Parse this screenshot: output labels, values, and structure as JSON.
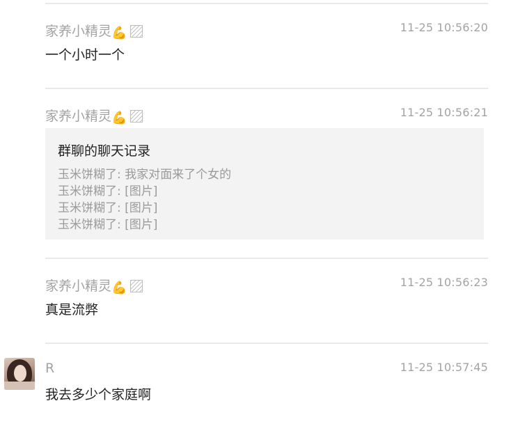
{
  "messages": [
    {
      "sender": "家养小精灵",
      "sender_emoji": "💪",
      "time": "11-25 10:56:20",
      "text": "一个小时一个"
    },
    {
      "sender": "家养小精灵",
      "sender_emoji": "💪",
      "time": "11-25 10:56:21",
      "forward": {
        "title": "群聊的聊天记录",
        "lines": [
          "玉米饼糊了: 我家对面来了个女的",
          "玉米饼糊了: [图片]",
          "玉米饼糊了: [图片]",
          "玉米饼糊了: [图片]"
        ]
      }
    },
    {
      "sender": "家养小精灵",
      "sender_emoji": "💪",
      "time": "11-25 10:56:23",
      "text": "真是流弊"
    },
    {
      "sender": "R",
      "time": "11-25 10:57:45",
      "text": "我去多少个家庭啊"
    }
  ]
}
